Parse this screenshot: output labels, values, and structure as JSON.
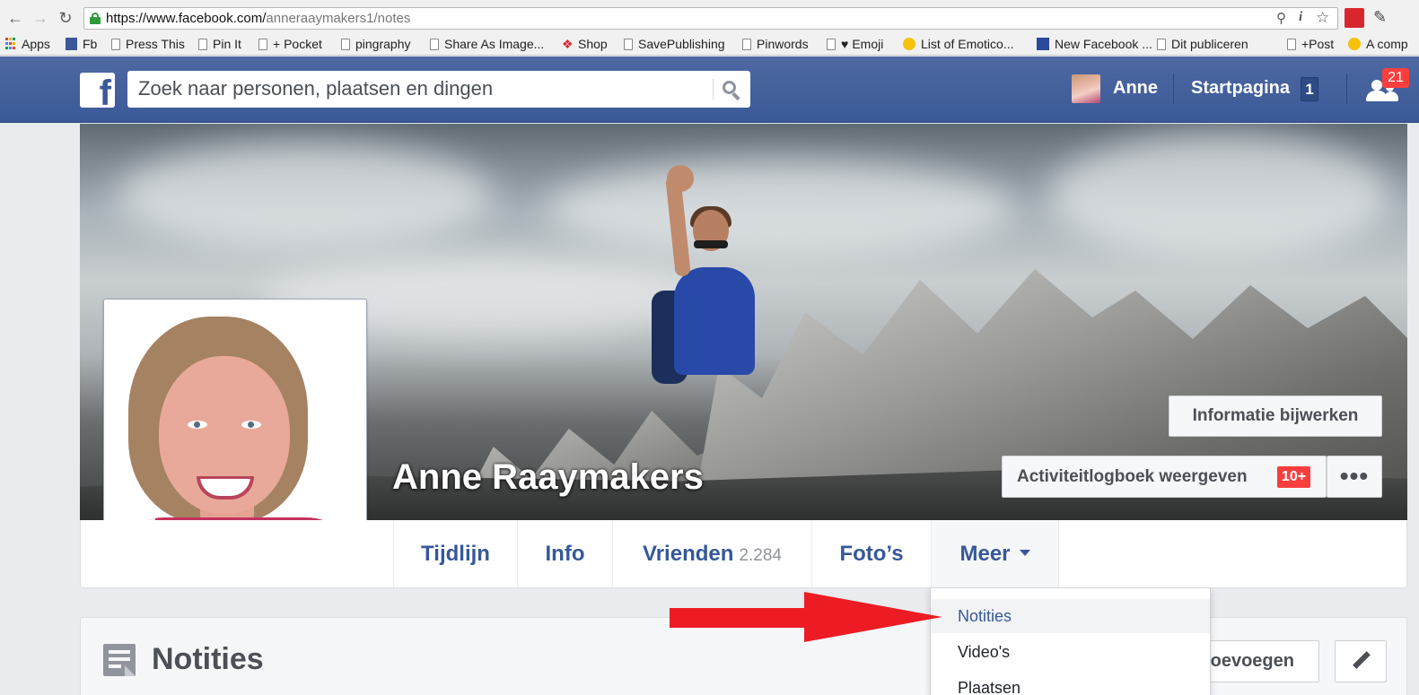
{
  "browser": {
    "url_host": "https://www.facebook.com/",
    "url_path": "anneraaymakers1/notes",
    "bookmarks": [
      "Apps",
      "Fb",
      "Press This",
      "Pin It",
      "+ Pocket",
      "pingraphy",
      "Share As Image...",
      "Shop",
      "SavePublishing",
      "Pinwords",
      "Emoji",
      "List of Emotico...",
      "New Facebook ...",
      "Dit publiceren",
      "+Post",
      "A comp"
    ]
  },
  "fbbar": {
    "logo": "f",
    "search_placeholder": "Zoek naar personen, plaatsen en dingen",
    "user_name": "Anne",
    "home_label": "Startpagina",
    "home_count": "1",
    "friend_requests": "21"
  },
  "cover": {
    "name": "Anne Raaymakers",
    "update_info_label": "Informatie bijwerken",
    "activity_log_label": "Activiteitlogboek weergeven",
    "activity_log_badge": "10+",
    "more_dots": "•••"
  },
  "tabs": [
    {
      "label": "Tijdlijn"
    },
    {
      "label": "Info"
    },
    {
      "label": "Vrienden",
      "count": "2.284"
    },
    {
      "label": "Foto’s"
    },
    {
      "label": "Meer"
    }
  ],
  "dropdown": {
    "items": [
      "Notities",
      "Video's",
      "Plaatsen"
    ],
    "active_index": 0
  },
  "notes": {
    "title": "Notities",
    "add_label": "toevoegen"
  },
  "colors": {
    "fb_blue": "#3b5998",
    "link_blue": "#365899",
    "badge_red": "#fa3e3e",
    "arrow_red": "#ed1c24"
  }
}
